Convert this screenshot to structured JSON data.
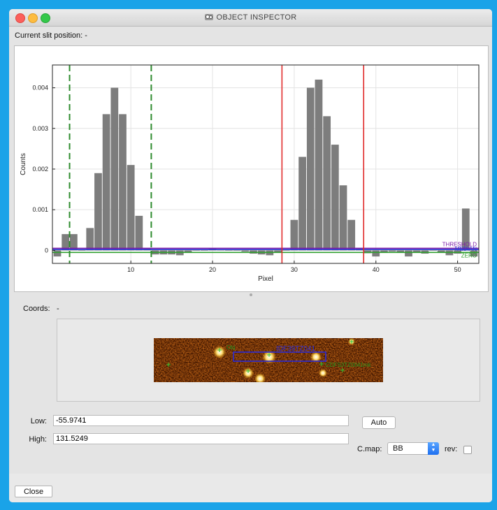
{
  "window": {
    "title": "OBJECT INSPECTOR",
    "slit_label": "Current slit position: -"
  },
  "colors": {
    "bar": "#7d7d7d",
    "threshold_line": "#7a1aa8",
    "median_line": "#2b3bd4",
    "zero_line": "#2f9e2f",
    "slit_edge": "#2e8b2e",
    "object_edge": "#e02a2a",
    "desktop": "#1aa3e8"
  },
  "chart_data": {
    "type": "bar",
    "xlabel": "Pixel",
    "ylabel": "Counts",
    "xlim": [
      0.4,
      52.6
    ],
    "ylim": [
      -0.00032,
      0.00456
    ],
    "xticks": [
      "10",
      "20",
      "30",
      "40",
      "50"
    ],
    "yticks": [
      "0",
      "0.001",
      "0.002",
      "0.003",
      "0.004"
    ],
    "grid": true,
    "x": [
      1,
      2,
      3,
      4,
      5,
      6,
      7,
      8,
      9,
      10,
      11,
      12,
      13,
      14,
      15,
      16,
      17,
      18,
      19,
      20,
      21,
      22,
      23,
      24,
      25,
      26,
      27,
      28,
      29,
      30,
      31,
      32,
      33,
      34,
      35,
      36,
      37,
      38,
      39,
      40,
      41,
      42,
      43,
      44,
      45,
      46,
      47,
      48,
      49,
      50,
      51,
      52
    ],
    "values": [
      -0.00015,
      0.0004,
      0.0004,
      0,
      0.00055,
      0.0019,
      0.00335,
      0.004,
      0.00335,
      0.0021,
      0.00085,
      5e-05,
      -0.0001,
      -0.0001,
      -0.0001,
      -0.00012,
      -5e-05,
      0,
      0,
      5e-05,
      3e-05,
      0,
      0,
      -3e-05,
      -8e-05,
      -0.0001,
      -0.00012,
      -5e-05,
      0,
      0.00075,
      0.0023,
      0.004,
      0.0042,
      0.0033,
      0.0026,
      0.0016,
      0.00075,
      5e-05,
      -7e-05,
      -0.00015,
      -5e-05,
      -3e-05,
      -5e-05,
      -0.00015,
      -5e-05,
      -8e-05,
      0,
      -5e-05,
      -0.00012,
      -8e-05,
      0.00103,
      -0.00015
    ],
    "hlines": [
      {
        "name": "THRESHOLD",
        "y": 5e-05
      },
      {
        "name": "MEDIAN",
        "y": 2e-05
      },
      {
        "name": "ZERO",
        "y": -5e-05
      }
    ],
    "slit_edges": [
      2.5,
      12.5
    ],
    "object_edges": [
      28.5,
      38.5
    ]
  },
  "labels": {
    "coords": "Coords:",
    "coords_value": "-",
    "low": "Low:",
    "high": "High:",
    "cmap": "C.map:",
    "rev": "rev:"
  },
  "thumbnail": {
    "object_id": "IDF39TZ041",
    "neighbor_id": "CDFS3TZ0041mk",
    "primary_label": "Obj"
  },
  "inputs": {
    "low": "-55.9741",
    "high": "131.5249"
  },
  "buttons": {
    "auto": "Auto",
    "close": "Close"
  },
  "cmap": {
    "selected": "BB"
  }
}
